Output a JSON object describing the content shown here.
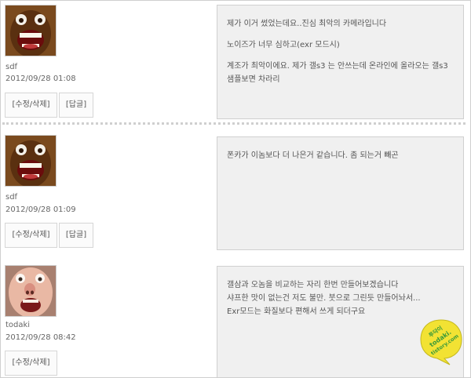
{
  "comments": [
    {
      "author": "sdf",
      "date": "2012/09/28 01:08",
      "buttons": {
        "edit": "[수정/삭제]",
        "reply": "[답글]"
      },
      "lines": [
        "제가 이거 썼었는데요..진심 최악의 카메라입니다",
        "",
        "노이즈가 너무 심하고(exr 모드시)",
        "",
        "계조가 최악이에요. 제가 갤s3 는 안쓰는데 온라인에 올라오는 갤s3",
        "샘플보면 차라리"
      ]
    },
    {
      "author": "sdf",
      "date": "2012/09/28 01:09",
      "buttons": {
        "edit": "[수정/삭제]",
        "reply": "[답글]"
      },
      "lines": [
        "폰카가 이놈보다 더 나은거 같습니다. 좀 되는거 빼곤"
      ]
    },
    {
      "author": "todaki",
      "date": "2012/09/28 08:42",
      "buttons": {
        "edit": "[수정/삭제]"
      },
      "lines": [
        "갤삼과 오놈을 비교하는 자리 한번 만들어보겠습니다",
        "샤프한 맛이 없는건 저도 불만. 붓으로 그린듯 만들어놔서...",
        "Exr모드는 화질보다 편해서 쓰게 되더구요"
      ]
    }
  ],
  "watermark": {
    "text_top": "투닥이",
    "text_mid": "todaki.",
    "text_bot": "tistory.com",
    "color": "#f2e233"
  }
}
